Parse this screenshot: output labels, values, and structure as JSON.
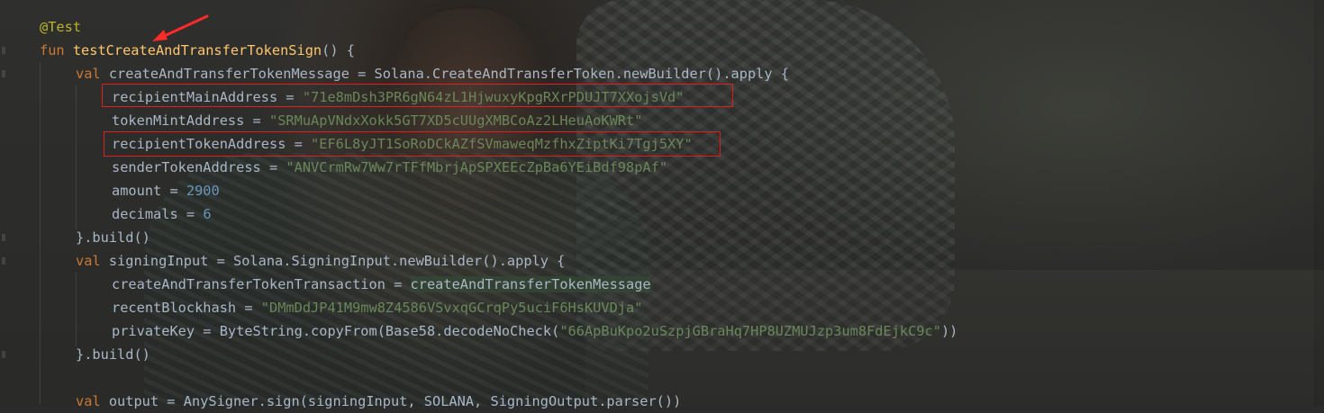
{
  "editor": {
    "theme_colors": {
      "background": "#2b2b2b",
      "keyword": "#cc7832",
      "annotation": "#bbb529",
      "function": "#ffc66d",
      "string": "#6a8759",
      "number": "#6897bb",
      "plain": "#a9b7c6",
      "annotation_box": "#e02020"
    },
    "lines": [
      {
        "indent": 0,
        "tokens": [
          {
            "t": "@Test",
            "c": "anno"
          }
        ]
      },
      {
        "indent": 0,
        "tokens": [
          {
            "t": "fun ",
            "c": "kw"
          },
          {
            "t": "testCreateAndTransferTokenSign",
            "c": "fn"
          },
          {
            "t": "() {",
            "c": "plain"
          }
        ]
      },
      {
        "indent": 1,
        "tokens": [
          {
            "t": "val ",
            "c": "kw"
          },
          {
            "t": "createAndTransferTokenMessage = Solana.CreateAndTransferToken.newBuilder().apply {",
            "c": "plain"
          }
        ]
      },
      {
        "indent": 2,
        "tokens": [
          {
            "t": "recipientMainAddress = ",
            "c": "plain"
          },
          {
            "t": "\"71e8mDsh3PR6gN64zL1HjwuxyKpgRXrPDUJT7XXojsVd\"",
            "c": "str"
          }
        ]
      },
      {
        "indent": 2,
        "tokens": [
          {
            "t": "tokenMintAddress = ",
            "c": "plain"
          },
          {
            "t": "\"SRMuApVNdxXokk5GT7XD5cUUgXMBCoAz2LHeuAoKWRt\"",
            "c": "str"
          }
        ]
      },
      {
        "indent": 2,
        "tokens": [
          {
            "t": "recipientTokenAddress = ",
            "c": "plain"
          },
          {
            "t": "\"EF6L8yJT1SoRoDCkAZfSVmaweqMzfhxZiptKi7Tgj5XY\"",
            "c": "str"
          }
        ]
      },
      {
        "indent": 2,
        "tokens": [
          {
            "t": "senderTokenAddress = ",
            "c": "plain"
          },
          {
            "t": "\"ANVCrmRw7Ww7rTFfMbrjApSPXEEcZpBa6YEiBdf98pAf\"",
            "c": "str"
          }
        ]
      },
      {
        "indent": 2,
        "tokens": [
          {
            "t": "amount = ",
            "c": "plain"
          },
          {
            "t": "2900",
            "c": "num"
          }
        ]
      },
      {
        "indent": 2,
        "tokens": [
          {
            "t": "decimals = ",
            "c": "plain"
          },
          {
            "t": "6",
            "c": "num"
          }
        ]
      },
      {
        "indent": 1,
        "tokens": [
          {
            "t": "}.build()",
            "c": "plain"
          }
        ]
      },
      {
        "indent": 1,
        "tokens": [
          {
            "t": "val ",
            "c": "kw"
          },
          {
            "t": "signingInput = Solana.SigningInput.newBuilder().apply {",
            "c": "plain"
          }
        ]
      },
      {
        "indent": 2,
        "tokens": [
          {
            "t": "createAndTransferTokenTransaction = ",
            "c": "plain"
          },
          {
            "t": "createAndTransferTokenMessage",
            "c": "hl"
          }
        ]
      },
      {
        "indent": 2,
        "tokens": [
          {
            "t": "recentBlockhash = ",
            "c": "plain"
          },
          {
            "t": "\"DMmDdJP41M9mw8Z4586VSvxqGCrqPy5uciF6HsKUVDja\"",
            "c": "str"
          }
        ]
      },
      {
        "indent": 2,
        "tokens": [
          {
            "t": "privateKey = ByteString.copyFrom(Base58.decodeNoCheck(",
            "c": "plain"
          },
          {
            "t": "\"66ApBuKpo2uSzpjGBraHq7HP8UZMUJzp3um8FdEjkC9c\"",
            "c": "str"
          },
          {
            "t": "))",
            "c": "plain"
          }
        ]
      },
      {
        "indent": 1,
        "tokens": [
          {
            "t": "}.build()",
            "c": "plain"
          }
        ]
      },
      {
        "indent": 0,
        "tokens": []
      },
      {
        "indent": 1,
        "tokens": [
          {
            "t": "val ",
            "c": "kw"
          },
          {
            "t": "output = AnySigner.sign(signingInput, SOLANA, SigningOutput.parser())",
            "c": "plain"
          }
        ]
      }
    ]
  }
}
